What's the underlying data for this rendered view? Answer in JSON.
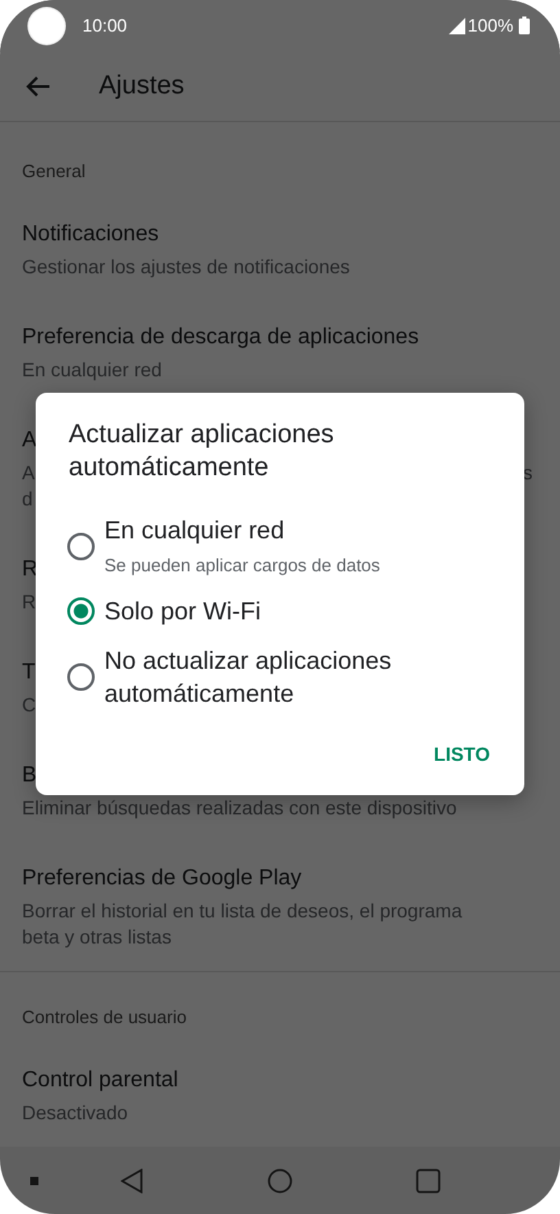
{
  "status_bar": {
    "time": "10:00",
    "battery": "100%"
  },
  "toolbar": {
    "title": "Ajustes"
  },
  "sections": [
    {
      "header": "General",
      "items": [
        {
          "title": "Notificaciones",
          "subtitle_lines": [
            "Gestionar los ajustes de notificaciones"
          ]
        },
        {
          "title": "Preferencia de descarga de aplicaciones",
          "subtitle_lines": [
            "En cualquier red"
          ]
        },
        {
          "title": "A",
          "subtitle_lines": [
            "A",
            "d"
          ],
          "subtitle_end": "s"
        },
        {
          "title": "R",
          "subtitle_lines": [
            "R"
          ]
        },
        {
          "title": "T",
          "subtitle_lines": [
            "C"
          ]
        },
        {
          "title": "B",
          "subtitle_lines": [
            "Eliminar búsquedas realizadas con este dispositivo"
          ]
        },
        {
          "title": "Preferencias de Google Play",
          "subtitle_lines": [
            "Borrar el historial en tu lista de deseos, el programa beta y otras listas"
          ]
        }
      ]
    },
    {
      "header": "Controles de usuario",
      "items": [
        {
          "title": "Control parental",
          "subtitle_lines": [
            "Desactivado"
          ]
        }
      ]
    }
  ],
  "dialog": {
    "title": "Actualizar aplicaciones automáticamente",
    "options": [
      {
        "label": "En cualquier red",
        "hint": "Se pueden aplicar cargos de datos",
        "selected": false
      },
      {
        "label": "Solo por Wi-Fi",
        "selected": true
      },
      {
        "label": "No actualizar aplicaciones automáticamente",
        "selected": false
      }
    ],
    "button": "LISTO"
  }
}
